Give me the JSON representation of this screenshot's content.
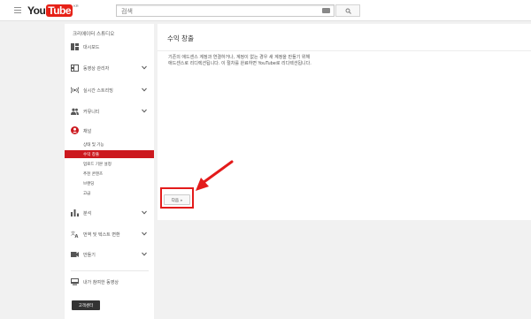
{
  "header": {
    "logo_you": "You",
    "logo_tube": "Tube",
    "logo_region": "KR",
    "search_placeholder": "검색"
  },
  "sidebar": {
    "title": "크리에이터 스튜디오",
    "items": [
      {
        "label": "대시보드",
        "icon": "dashboard-icon",
        "expandable": false
      },
      {
        "label": "동영상 관리자",
        "icon": "video-manager-icon",
        "expandable": true
      },
      {
        "label": "실시간 스트리밍",
        "icon": "live-streaming-icon",
        "expandable": true
      },
      {
        "label": "커뮤니티",
        "icon": "community-icon",
        "expandable": true
      },
      {
        "label": "채널",
        "icon": "channel-icon",
        "expandable": false
      },
      {
        "label": "분석",
        "icon": "analytics-icon",
        "expandable": true
      },
      {
        "label": "번역 및 텍스트 변환",
        "icon": "translate-icon",
        "expandable": true
      },
      {
        "label": "만들기",
        "icon": "create-icon",
        "expandable": true
      },
      {
        "label": "내가 참여한 동영상",
        "icon": "contributions-icon",
        "expandable": false
      }
    ],
    "channel_subitems": [
      {
        "label": "상태 및 기능",
        "active": false
      },
      {
        "label": "수익 창출",
        "active": true
      },
      {
        "label": "업로드 기본 설정",
        "active": false
      },
      {
        "label": "추천 콘텐츠",
        "active": false
      },
      {
        "label": "브랜딩",
        "active": false
      },
      {
        "label": "고급",
        "active": false
      }
    ],
    "help_button": "고객센터"
  },
  "main": {
    "title": "수익 창출",
    "description_line1": "기존의 애드센스 계정과 연결하거나, 계정이 없는 경우 새 계정을 만들기 위해",
    "description_line2": "애드센스로 리디렉션됩니다. 이 절차를 완료하면 YouTube로 리디렉션됩니다.",
    "next_button": "다음 »"
  },
  "colors": {
    "brand_red": "#e62117",
    "active_red": "#cc181e",
    "annotation_red": "#e31b1b"
  }
}
